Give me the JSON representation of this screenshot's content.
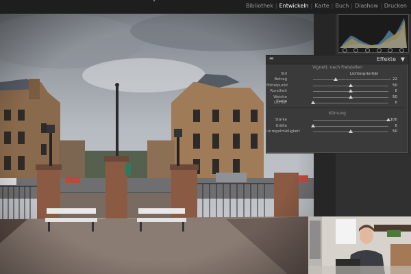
{
  "modules": {
    "items": [
      "Bibliothek",
      "Entwickeln",
      "Karte",
      "Buch",
      "Diashow",
      "Drucken"
    ],
    "active": "Entwickeln",
    "separator": "|"
  },
  "panel": {
    "title": "Effekte",
    "vignette": {
      "title": "Vignett. nach Freistellen",
      "style_label": "Stil",
      "style_value": "Lichterpriorität",
      "sliders": [
        {
          "label": "Betrag",
          "value": "− 22"
        },
        {
          "label": "Mittelpunkt",
          "value": "50"
        },
        {
          "label": "Rundheit",
          "value": "0"
        },
        {
          "label": "Weiche Kante",
          "value": "50"
        },
        {
          "label": "Lichter",
          "value": "0"
        }
      ]
    },
    "grain": {
      "title": "Körnung",
      "sliders": [
        {
          "label": "Stärke",
          "value": "100"
        },
        {
          "label": "Größe",
          "value": "0"
        },
        {
          "label": "Unregelmäßigkeit",
          "value": "50"
        }
      ]
    }
  },
  "colors": {
    "accent_active_module": "#ffffff",
    "panel_bg": "#3a3a3a"
  }
}
